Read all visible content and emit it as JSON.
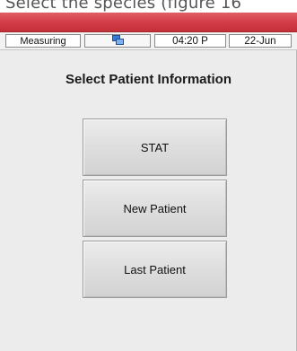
{
  "caption": {
    "text": "Select the species (figure 16"
  },
  "status_bar": {
    "mode": "Measuring",
    "status_icon": "network-status-icon",
    "time": "04:20 P",
    "date": "22-Jun"
  },
  "screen": {
    "heading": "Select Patient Information",
    "buttons": {
      "stat": "STAT",
      "new_patient": "New Patient",
      "last_patient": "Last Patient"
    }
  },
  "colors": {
    "title_bar": "#d23c46",
    "screen_background": "#ececec",
    "button_face": "#dedede"
  }
}
